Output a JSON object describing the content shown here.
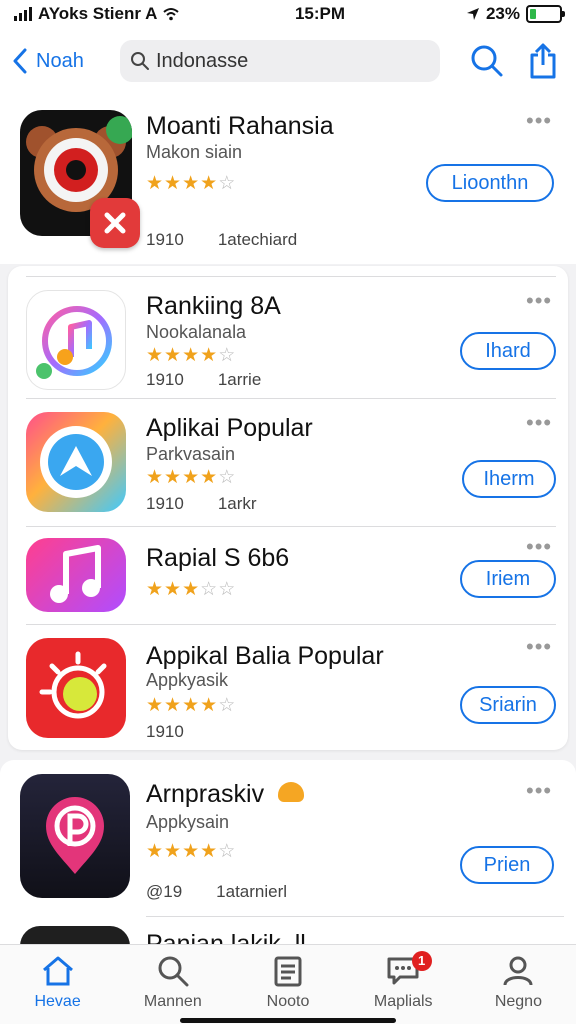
{
  "status_bar": {
    "carrier": "AYoks Stienr A",
    "time": "15:PM",
    "battery": "23%",
    "battery_level": 0.23
  },
  "nav": {
    "back_label": "Noah",
    "search_value": "Indonasse"
  },
  "featured_app": {
    "name": "Moanti Rahansia",
    "subtitle": "Makon siain",
    "rating": 3.5,
    "meta_a": "1910",
    "meta_b": "1atechiard",
    "button": "Lioonthn"
  },
  "list": [
    {
      "name": "Rankiing 8A",
      "subtitle": "Nookalanala",
      "rating": 3.5,
      "meta_a": "1910",
      "meta_b": "1arrie",
      "button": "Ihard"
    },
    {
      "name": "Aplikai Popular",
      "subtitle": "Parkvasain",
      "rating": 3.5,
      "meta_a": "1910",
      "meta_b": "1arkr",
      "button": "Iherm"
    },
    {
      "name": "Rapial S 6b6",
      "subtitle": "",
      "rating": 2.5,
      "meta_a": "",
      "meta_b": "",
      "button": "Iriem"
    },
    {
      "name": "Appikal Balia Popular",
      "subtitle": "Appkyasik",
      "rating": 3.5,
      "meta_a": "1910",
      "meta_b": "",
      "button": "Sriarin"
    }
  ],
  "featured_app_2": {
    "name": "Arnpraskiv",
    "subtitle": "Appkysain",
    "rating": 3.5,
    "meta_a": "@19",
    "meta_b": "1atarnierl",
    "button": "Prien",
    "next_partial": "Panian lakik .ll"
  },
  "tabs": [
    {
      "label": "Hevae",
      "icon": "home-icon"
    },
    {
      "label": "Mannen",
      "icon": "search-icon"
    },
    {
      "label": "Nooto",
      "icon": "clipboard-icon"
    },
    {
      "label": "Maplials",
      "icon": "message-icon",
      "badge": "1"
    },
    {
      "label": "Negno",
      "icon": "person-icon"
    }
  ],
  "colors": {
    "accent": "#1673e6",
    "star": "#f0a21c",
    "badge": "#e02020"
  }
}
